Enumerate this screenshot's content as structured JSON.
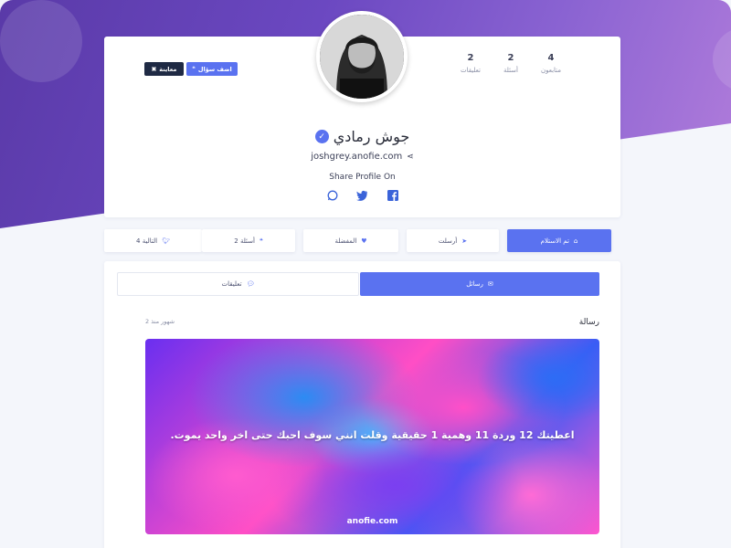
{
  "profile": {
    "name": "جوش رمادي",
    "website": "joshgrey.anofie.com",
    "share_label": "Share Profile On",
    "stats": [
      {
        "value": "4",
        "label": "متابعون"
      },
      {
        "value": "2",
        "label": "أسئلة"
      },
      {
        "value": "2",
        "label": "تعليقات"
      }
    ],
    "buttons": {
      "preview": "معاينة",
      "ask": "اضف سؤال"
    },
    "social": [
      "facebook-icon",
      "twitter-icon",
      "whatsapp-icon"
    ]
  },
  "tabs": [
    {
      "label": "تم الاستلام",
      "icon": "inbox-icon"
    },
    {
      "label": "أرسلت",
      "icon": "paper-plane-icon"
    },
    {
      "label": "المفضلة",
      "icon": "heart-icon"
    },
    {
      "label": "أسئلة 2",
      "icon": "quote-icon"
    },
    {
      "label": "التالية 4",
      "icon": "twitter-icon"
    }
  ],
  "subtabs": {
    "messages": "رسائل",
    "comments": "تعليقات"
  },
  "message": {
    "title": "رسالة",
    "time": "2 شهور منذ",
    "text": "اعطيتك 12 وردة 11 وهمية 1 حقيقية وقلت انني سوف احبك حتى اخر واحد يموت.",
    "brand": "anofie.com"
  },
  "colors": {
    "accent": "#5a72f0",
    "dark_button": "#1f2a44",
    "hero_start": "#5a3aa8",
    "hero_end": "#b27ddb"
  }
}
